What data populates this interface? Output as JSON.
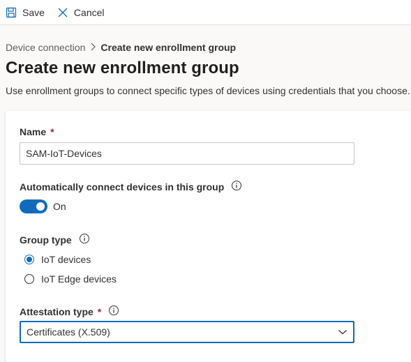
{
  "toolbar": {
    "save_label": "Save",
    "cancel_label": "Cancel"
  },
  "breadcrumb": {
    "parent": "Device connection",
    "separator": ">",
    "current": "Create new enrollment group"
  },
  "page": {
    "title": "Create new enrollment group",
    "description": "Use enrollment groups to connect specific types of devices using credentials that you choose."
  },
  "form": {
    "name": {
      "label": "Name",
      "required_mark": "*",
      "value": "SAM-IoT-Devices"
    },
    "auto_connect": {
      "label": "Automatically connect devices in this group",
      "toggle_state": "On",
      "enabled": true
    },
    "group_type": {
      "label": "Group type",
      "options": [
        {
          "label": "IoT devices",
          "selected": true
        },
        {
          "label": "IoT Edge devices",
          "selected": false
        }
      ]
    },
    "attestation_type": {
      "label": "Attestation type",
      "required_mark": "*",
      "selected": "Certificates (X.509)"
    }
  },
  "colors": {
    "accent": "#0f6cbd",
    "required": "#a4262c"
  },
  "icons": [
    "save-icon",
    "close-icon",
    "chevron-right-icon",
    "info-icon",
    "chevron-down-icon"
  ]
}
